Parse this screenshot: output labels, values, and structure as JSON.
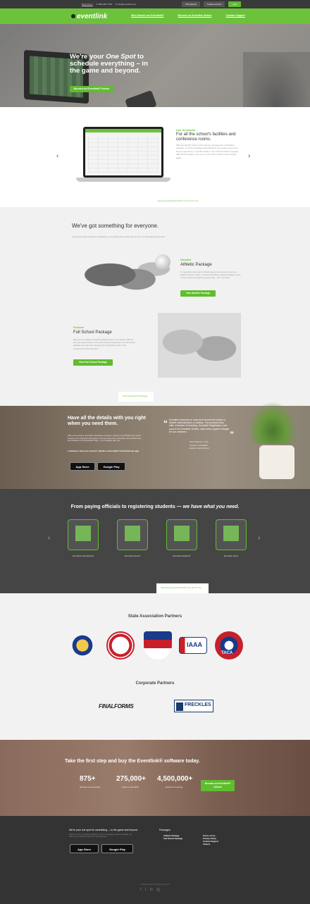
{
  "topbar": {
    "links": [
      "Book Demo",
      "✆ 866-936-7758",
      "✉ info@eventlink.com"
    ],
    "find_events": "Find Events",
    "create_account": "Create Account",
    "login": "Login"
  },
  "nav": {
    "logo": "eventlink",
    "items": [
      "Who Should use Eventlink®",
      "Become an Eventlink School",
      "Contact Support"
    ]
  },
  "hero": {
    "headline_pre": "We're your ",
    "headline_em": "One Spot",
    "headline_post": " to schedule everything – in the game and beyond.",
    "cta": "Become an Eventlink® School",
    "tab": "Become an Eventlink® School"
  },
  "scheduler": {
    "kicker": "Use Scheduler",
    "title": "For all the school's facilities and conference rooms.",
    "body": "With Eventlink® Utility hosts running management, scheduling software, as well as building administrators can create events and keep a request for a specific facility in the school's facility manager. With all the details in one spot, you'll never double book a facility again.",
    "prev": "‹",
    "next": "›",
    "tab": "View Everything Eventlink® Can Do For You"
  },
  "packages": {
    "heading": "We've got something for everyone.",
    "sub": "Looking for basic athletics scheduling or something the whole school can use? Eventlink® has both.",
    "athletic": {
      "kicker": "Standard",
      "title": "Athletic Package",
      "body": "It is great into planning an athletic season and whether you're an athletic director, coach, or official, Eventlink's athletic package is here to keep track of everything in game day – all in one spot.",
      "button": "View Athletic Package"
    },
    "fullschool": {
      "kicker": "Premium",
      "title": "Full School Package",
      "body": "Why pay for multiple scheduling platforms when one will do it all? For the busy administrator or the entire athletic department, the Full School package can help with manage their scheduling needs in the environment of the institution.",
      "button": "View Full School Package"
    },
    "tab": "View Eventlink® Packages"
  },
  "app": {
    "headline": "Have all the details with you right when you need them.",
    "body": "With every student, Eventlink schedulers, coaches, parents, and officials have quick access to the important information, and can view event schedules, bus arrival times, and facilities on the Eventlink® app – so it's always with you.",
    "cta": "Looking to view your school's details on Eventlink? Download the app!",
    "app_store": "App Store",
    "google_play": "Google Play",
    "quote": "Eventlink continues to meet and exceed the needs of athletic administrators in Indiana. The products they offer, Eventlink Scheduling, Eventlink Registration, and soon to be Eventlink Tickets, have been a game changer for our members.",
    "attribution": [
      "Scott Stevens, CAA",
      "Director of Athletics",
      "Lebanon High School"
    ]
  },
  "tools": {
    "headline_pre": "From paying officials to registering students — ",
    "headline_em": "we have what you need.",
    "items": [
      "Eventlink Scheduling®",
      "Eventlink Store®",
      "Eventlink Athletic®",
      "Eventlink Pay®"
    ],
    "prev": "‹",
    "next": "›",
    "tab": "View Everything Eventlink® Can Do for You"
  },
  "partners": {
    "state_heading": "State Association Partners",
    "badges": [
      "IHSAA",
      "IHSAA",
      "ISAA",
      "IAAA",
      "TACA"
    ],
    "corporate_heading": "Corporate Partners",
    "finalforms": "FINALFORMS",
    "freckles": "FRECKLES"
  },
  "cta": {
    "headline": "Take the first step and buy the Eventlink® software today.",
    "stats": [
      {
        "value": "875+",
        "label": "Schools use Eventlink"
      },
      {
        "value": "275,000+",
        "label": "Users in Eventlink"
      },
      {
        "value": "4,500,000+",
        "label": "Events & counting"
      }
    ],
    "button": "Become an Eventlink® School"
  },
  "footer": {
    "heading": "We're your one spot for scheduling — in the game and beyond.",
    "body": "Whether you're scheduling athletic events or managing a district calendar, our easy-to-use software helps you stay organized.",
    "app_store": "App Store",
    "google_play": "Google Play",
    "packages_heading": "Packages",
    "packages": [
      "Athletic Package",
      "Full School Package"
    ],
    "legal": [
      "Terms of Use",
      "Privacy Policy",
      "Contact Support",
      "Careers"
    ],
    "copyright": "© 2023 Eventlink. All rights reserved.",
    "social": [
      "f",
      "t",
      "in",
      "ig"
    ]
  }
}
